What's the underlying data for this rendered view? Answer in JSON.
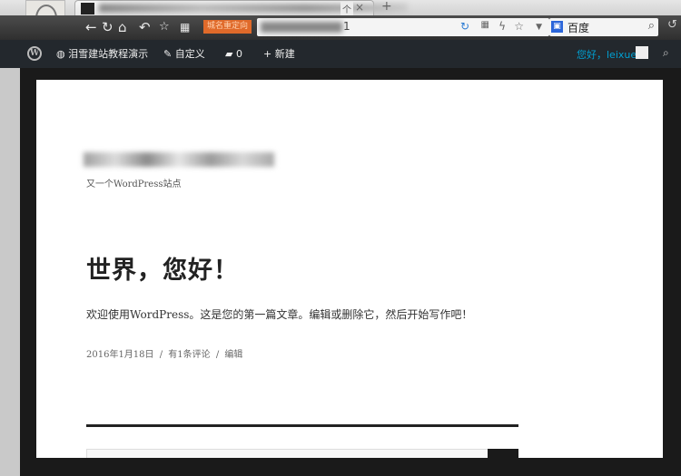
{
  "browser": {
    "tab_title_suffix": "个",
    "tab_close": "×",
    "new_tab": "+",
    "red_label": "城名重定向",
    "url_visible": "1",
    "search_engine": "百度",
    "icons": [
      "back-icon",
      "reload-icon",
      "home-icon",
      "undo-icon",
      "star-icon",
      "apps-icon",
      "refresh-icon",
      "qr-icon",
      "bolt-icon",
      "bookmark-icon",
      "dropdown-icon",
      "search-icon"
    ]
  },
  "adminbar": {
    "site_name": "泪雪建站教程演示",
    "customize": "自定义",
    "comments_count": "0",
    "new_label": "新建",
    "greeting": "您好，leixue"
  },
  "site": {
    "tagline": "又一个WordPress站点"
  },
  "post": {
    "title": "世界，您好！",
    "content": "欢迎使用WordPress。这是您的第一篇文章。编辑或删除它，然后开始写作吧！",
    "date": "2016年1月18日",
    "comments_link": "有1条评论",
    "edit_link": "编辑",
    "separator": "/"
  }
}
